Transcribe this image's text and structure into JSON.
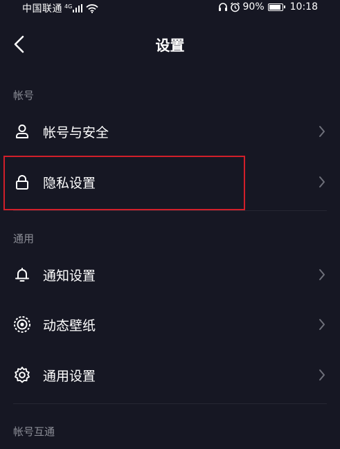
{
  "status_bar": {
    "carrier": "中国联通",
    "network": "4G",
    "battery_percent": "90%",
    "battery_level": 0.9,
    "time": "10:18"
  },
  "header": {
    "title": "设置"
  },
  "sections": [
    {
      "title": "帐号",
      "items": [
        {
          "label": "帐号与安全",
          "icon": "user-icon"
        },
        {
          "label": "隐私设置",
          "icon": "lock-icon"
        }
      ]
    },
    {
      "title": "通用",
      "items": [
        {
          "label": "通知设置",
          "icon": "bell-icon"
        },
        {
          "label": "动态壁纸",
          "icon": "wallpaper-icon"
        },
        {
          "label": "通用设置",
          "icon": "gear-icon"
        }
      ]
    },
    {
      "title": "帐号互通",
      "items": []
    }
  ],
  "colors": {
    "background": "#161723",
    "text": "#ffffff",
    "section_header": "#8b8d96",
    "chevron": "#6e707a",
    "highlight": "#d21f2a"
  }
}
